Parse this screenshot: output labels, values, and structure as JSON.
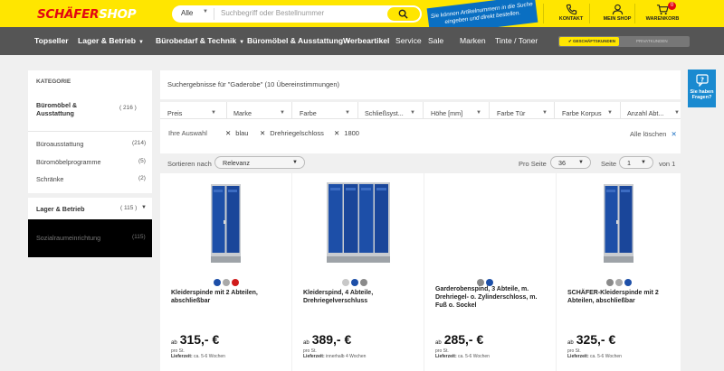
{
  "header": {
    "logo_part1": "SCHÄFER",
    "logo_part2": "SHOP",
    "search_category": "Alle",
    "search_placeholder": "Suchbegriff oder Bestellnummer",
    "banner_text": "Sie können Artikelnummern in die Suche eingeben und direkt bestellen.",
    "icons": [
      {
        "label": "KONTAKT",
        "icon": "phone-icon"
      },
      {
        "label": "MEIN SHOP",
        "icon": "user-icon"
      },
      {
        "label": "WARENKORB",
        "icon": "cart-icon"
      }
    ],
    "cart_count": "0"
  },
  "nav": {
    "items": [
      {
        "label": "Topseller",
        "bold": true
      },
      {
        "label": "Lager & Betrieb",
        "bold": true
      },
      {
        "label": "Bürobedarf & Technik",
        "bold": true
      },
      {
        "label": "Büromöbel & Ausstattung",
        "bold": true
      },
      {
        "label": "Werbeartikel",
        "bold": true
      },
      {
        "label": "Service",
        "bold": false
      },
      {
        "label": "Sale",
        "bold": false
      },
      {
        "label": "Marken",
        "bold": false
      },
      {
        "label": "Tinte / Toner",
        "bold": false
      }
    ],
    "toggle_active": "GESCHÄFTSKUNDEN",
    "toggle_inactive": "PRIVATKUNDEN"
  },
  "sidebar": {
    "heading": "KATEGORIE",
    "group1": {
      "label": "Büromöbel & Ausstattung",
      "count": "( 216 )"
    },
    "group1_items": [
      {
        "label": "Büroausstattung",
        "count": "(214)"
      },
      {
        "label": "Büromöbelprogramme",
        "count": "(5)"
      },
      {
        "label": "Schränke",
        "count": "(2)"
      }
    ],
    "group2": {
      "label": "Lager & Betrieb",
      "count": "( 115 )"
    },
    "group2_items": [
      {
        "label": "Sozialraumeinrichtung",
        "count": "(115)"
      }
    ]
  },
  "results": {
    "summary": "Suchergebnisse für \"Gaderobe\" (10 Übereinstimmungen)",
    "filters": [
      "Preis",
      "Marke",
      "Farbe",
      "Schließsyst...",
      "Höhe [mm]",
      "Farbe Tür",
      "Farbe Korpus",
      "Anzahl Abt..."
    ],
    "selection_label": "Ihre Auswahl",
    "chips": [
      "blau",
      "Drehriegelschloss",
      "1800"
    ],
    "clear_all": "Alle löschen",
    "sort_label": "Sortieren nach",
    "sort_value": "Relevanz",
    "per_page_label": "Pro Seite",
    "per_page_value": "36",
    "page_label": "Seite",
    "page_value": "1",
    "page_of": "von 1"
  },
  "products": [
    {
      "name": "Kleiderspinde mit 2 Abteilen, abschließbar",
      "ab": "ab",
      "price": "315,- €",
      "unit": "pro St.",
      "lieferzeit_label": "Lieferzeit:",
      "lieferzeit": "ca. 5-6 Wochen",
      "swatches": [
        "#1d4fa8",
        "#a9a9a9",
        "#d01b1b"
      ]
    },
    {
      "name": "Kleiderspind, 4 Abteile, Drehriegelverschluss",
      "ab": "ab",
      "price": "389,- €",
      "unit": "pro St.",
      "lieferzeit_label": "Lieferzeit:",
      "lieferzeit": "innerhalb 4 Wochen",
      "swatches": [
        "#c8c8c8",
        "#1d4fa8",
        "#8a8a8a"
      ]
    },
    {
      "name": "Garderobenspind, 3 Abteile, m. Drehriegel- o. Zylinderschloss, m. Fuß o. Sockel",
      "ab": "ab",
      "price": "285,- €",
      "unit": "pro St.",
      "lieferzeit_label": "Lieferzeit:",
      "lieferzeit": "ca. 5-6 Wochen",
      "swatches": [
        "#8a8a8a",
        "#1d4fa8"
      ]
    },
    {
      "name": "SCHÄFER-Kleiderspinde mit 2 Abteilen, abschließbar",
      "ab": "ab",
      "price": "325,- €",
      "unit": "pro St.",
      "lieferzeit_label": "Lieferzeit:",
      "lieferzeit": "ca. 5-6 Wochen",
      "swatches": [
        "#8a8a8a",
        "#a9a9a9",
        "#1d4fa8"
      ]
    }
  ],
  "help": {
    "line1": "Sie haben",
    "line2": "Fragen?"
  },
  "colors": {
    "brand_yellow": "#ffe600",
    "brand_red": "#e30613",
    "nav_gray": "#555555",
    "locker_blue": "#1d4fa8",
    "help_blue": "#1a8ad0"
  }
}
